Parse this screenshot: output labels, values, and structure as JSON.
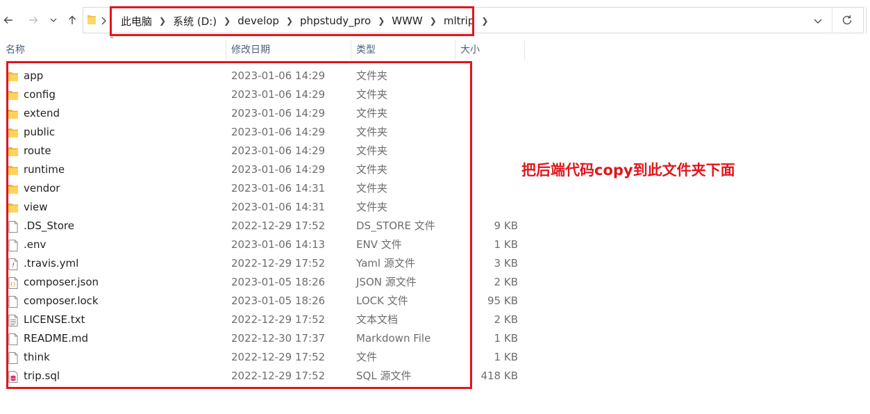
{
  "toolbar": {
    "back_icon": "arrow-left-icon",
    "forward_icon": "arrow-right-icon",
    "recent_icon": "chevron-down-icon",
    "up_icon": "arrow-up-icon",
    "refresh_icon": "refresh-icon"
  },
  "breadcrumb": [
    "此电脑",
    "系统 (D:)",
    "develop",
    "phpstudy_pro",
    "WWW",
    "mltrip"
  ],
  "columns": {
    "name": "名称",
    "date": "修改日期",
    "type": "类型",
    "size": "大小"
  },
  "files": [
    {
      "name": "app",
      "date": "2023-01-06 14:29",
      "type": "文件夹",
      "size": "",
      "icon": "folder-icon"
    },
    {
      "name": "config",
      "date": "2023-01-06 14:29",
      "type": "文件夹",
      "size": "",
      "icon": "folder-icon"
    },
    {
      "name": "extend",
      "date": "2023-01-06 14:29",
      "type": "文件夹",
      "size": "",
      "icon": "folder-icon"
    },
    {
      "name": "public",
      "date": "2023-01-06 14:29",
      "type": "文件夹",
      "size": "",
      "icon": "folder-icon"
    },
    {
      "name": "route",
      "date": "2023-01-06 14:29",
      "type": "文件夹",
      "size": "",
      "icon": "folder-icon"
    },
    {
      "name": "runtime",
      "date": "2023-01-06 14:29",
      "type": "文件夹",
      "size": "",
      "icon": "folder-icon"
    },
    {
      "name": "vendor",
      "date": "2023-01-06 14:31",
      "type": "文件夹",
      "size": "",
      "icon": "folder-icon"
    },
    {
      "name": "view",
      "date": "2023-01-06 14:31",
      "type": "文件夹",
      "size": "",
      "icon": "folder-icon"
    },
    {
      "name": ".DS_Store",
      "date": "2022-12-29 17:52",
      "type": "DS_STORE 文件",
      "size": "9 KB",
      "icon": "file-icon"
    },
    {
      "name": ".env",
      "date": "2023-01-06 14:13",
      "type": "ENV 文件",
      "size": "1 KB",
      "icon": "file-icon"
    },
    {
      "name": ".travis.yml",
      "date": "2022-12-29 17:52",
      "type": "Yaml 源文件",
      "size": "3 KB",
      "icon": "yaml-file-icon"
    },
    {
      "name": "composer.json",
      "date": "2023-01-05 18:26",
      "type": "JSON 源文件",
      "size": "2 KB",
      "icon": "json-file-icon"
    },
    {
      "name": "composer.lock",
      "date": "2023-01-05 18:26",
      "type": "LOCK 文件",
      "size": "95 KB",
      "icon": "file-icon"
    },
    {
      "name": "LICENSE.txt",
      "date": "2022-12-29 17:52",
      "type": "文本文档",
      "size": "2 KB",
      "icon": "text-file-icon"
    },
    {
      "name": "README.md",
      "date": "2022-12-30 17:37",
      "type": "Markdown File",
      "size": "1 KB",
      "icon": "file-icon"
    },
    {
      "name": "think",
      "date": "2022-12-29 17:52",
      "type": "文件",
      "size": "1 KB",
      "icon": "file-icon"
    },
    {
      "name": "trip.sql",
      "date": "2022-12-29 17:52",
      "type": "SQL 源文件",
      "size": "418 KB",
      "icon": "sql-file-icon"
    }
  ],
  "annotation": {
    "text": "把后端代码copy到此文件夹下面",
    "color": "#e2151b"
  }
}
